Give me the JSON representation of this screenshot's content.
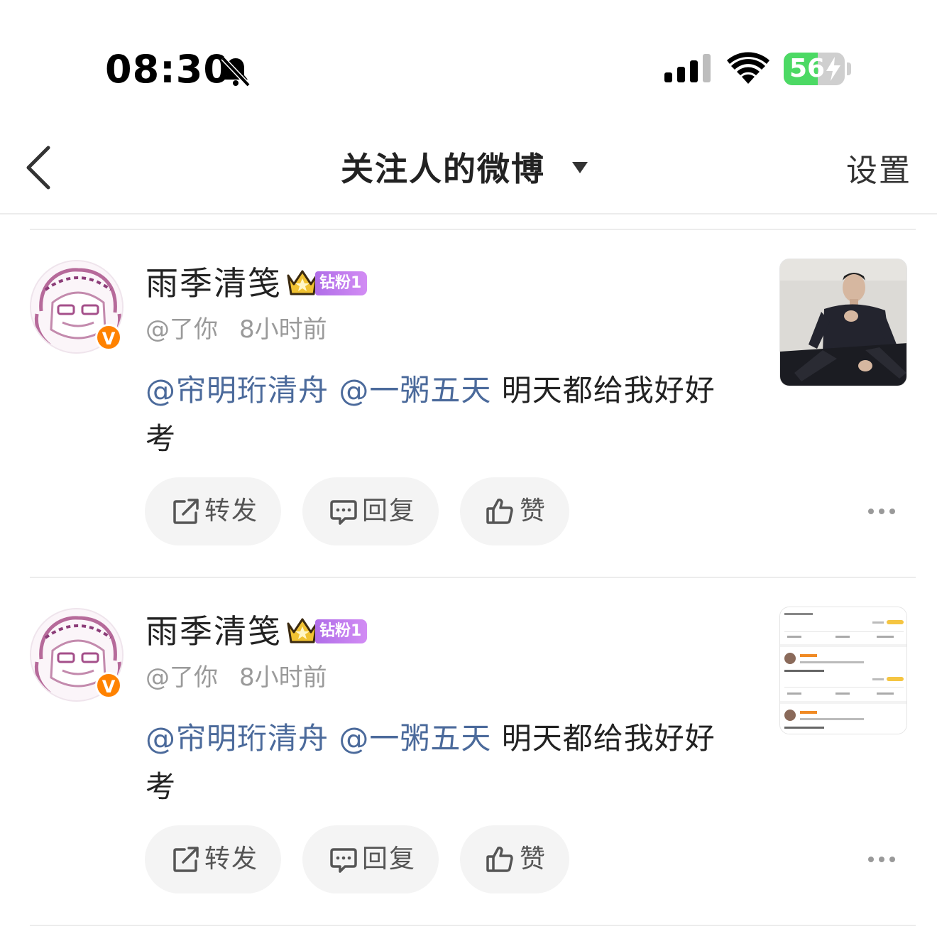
{
  "status_bar": {
    "time": "08:30",
    "battery": "56",
    "battery_level": 0.56
  },
  "nav": {
    "title": "关注人的微博",
    "settings": "设置"
  },
  "colors": {
    "mention": "#4b6a9b",
    "verified": "#ff8200",
    "fan_badge": "#c17ff0",
    "battery_green": "#4cd964"
  },
  "posts": [
    {
      "username": "雨季清笺",
      "fan_badge": "钻粉1",
      "verified": "V",
      "meta_prefix": "@了你",
      "meta_time": "8小时前",
      "mention1": "@帘明珩清舟",
      "mention2": "@一粥五天",
      "text": " 明天都给我好好考",
      "thumbnail": "photo-man-dark-outfit",
      "actions": {
        "repost": "转发",
        "reply": "回复",
        "like": "赞"
      }
    },
    {
      "username": "雨季清笺",
      "fan_badge": "钻粉1",
      "verified": "V",
      "meta_prefix": "@了你",
      "meta_time": "8小时前",
      "mention1": "@帘明珩清舟",
      "mention2": "@一粥五天",
      "text": " 明天都给我好好考",
      "thumbnail": "screenshot-thumbnail",
      "actions": {
        "repost": "转发",
        "reply": "回复",
        "like": "赞"
      }
    }
  ]
}
